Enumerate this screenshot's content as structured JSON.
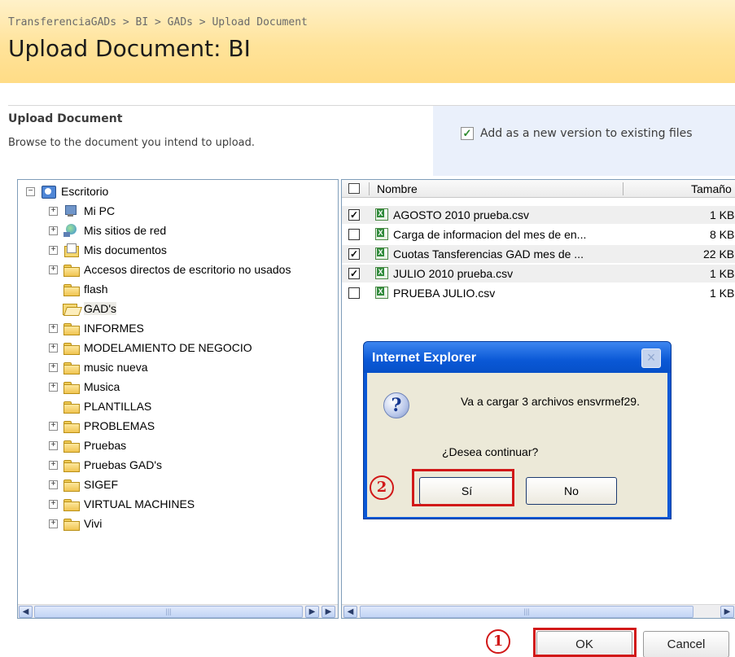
{
  "header": {
    "breadcrumb": "TransferenciaGADs > BI > GADs > Upload Document",
    "title": "Upload Document: BI"
  },
  "upload": {
    "section_title": "Upload Document",
    "section_desc": "Browse to the document you intend to upload.",
    "version_checked": true,
    "version_label": "Add as a new version to existing files"
  },
  "tree": {
    "items": [
      {
        "label": "Escritorio",
        "icon": "desktop-icon"
      },
      {
        "label": "Mi PC",
        "icon": "computer-icon"
      },
      {
        "label": "Mis sitios de red",
        "icon": "network-icon"
      },
      {
        "label": "Mis documentos",
        "icon": "documents-folder-icon"
      },
      {
        "label": "Accesos directos de escritorio no usados",
        "icon": "folder-icon"
      },
      {
        "label": "flash",
        "icon": "folder-icon"
      },
      {
        "label": "GAD's",
        "icon": "open-folder-icon",
        "selected": true
      },
      {
        "label": "INFORMES",
        "icon": "folder-icon"
      },
      {
        "label": "MODELAMIENTO DE NEGOCIO",
        "icon": "folder-icon"
      },
      {
        "label": "music nueva",
        "icon": "folder-icon"
      },
      {
        "label": "Musica",
        "icon": "folder-icon"
      },
      {
        "label": "PLANTILLAS",
        "icon": "folder-icon"
      },
      {
        "label": "PROBLEMAS",
        "icon": "folder-icon"
      },
      {
        "label": "Pruebas",
        "icon": "folder-icon"
      },
      {
        "label": "Pruebas GAD's",
        "icon": "folder-icon"
      },
      {
        "label": "SIGEF",
        "icon": "folder-icon"
      },
      {
        "label": "VIRTUAL MACHINES",
        "icon": "folder-icon"
      },
      {
        "label": "Vivi",
        "icon": "folder-icon"
      }
    ],
    "expander_collapse": "−",
    "expander_expand": "+"
  },
  "files": {
    "col_name": "Nombre",
    "col_size": "Tamaño",
    "rows": [
      {
        "name": "AGOSTO 2010 prueba.csv",
        "size": "1 KB",
        "checked": true
      },
      {
        "name": "Carga de informacion del mes de en...",
        "size": "8 KB",
        "checked": false
      },
      {
        "name": "Cuotas Tansferencias GAD mes de ...",
        "size": "22 KB",
        "checked": true
      },
      {
        "name": "JULIO 2010 prueba.csv",
        "size": "1 KB",
        "checked": true
      },
      {
        "name": "PRUEBA JULIO.csv",
        "size": "1 KB",
        "checked": false
      }
    ]
  },
  "dialog": {
    "title": "Internet Explorer",
    "message": "Va a cargar 3 archivos ensvrmef29.",
    "question": "¿Desea continuar?",
    "yes_label": "Sí",
    "no_label": "No",
    "close_glyph": "×",
    "icon_glyph": "?"
  },
  "annotations": {
    "step1": "1",
    "step2": "2"
  },
  "actions": {
    "ok_label": "OK",
    "cancel_label": "Cancel"
  },
  "scrollbar": {
    "left_glyph": "◀",
    "right_glyph": "▶",
    "thumb_grip": "|||"
  },
  "colors": {
    "header_gradient": "#ffe39a",
    "dialog_title": "#0a58d6",
    "annotation_red": "#d11818",
    "version_panel": "#eaf0fb"
  }
}
